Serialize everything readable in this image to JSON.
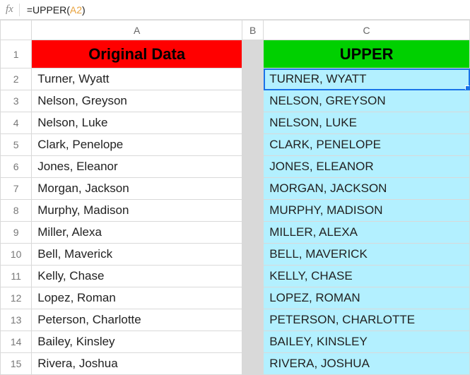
{
  "formula_bar": {
    "prefix": "=UPPER(",
    "ref": "A2",
    "suffix": ")"
  },
  "columns": {
    "a": "A",
    "b": "B",
    "c": "C"
  },
  "headers": {
    "original": "Original Data",
    "upper": "UPPER"
  },
  "rows": [
    {
      "num": "1"
    },
    {
      "num": "2",
      "a": "Turner, Wyatt",
      "c": "TURNER, WYATT"
    },
    {
      "num": "3",
      "a": "Nelson, Greyson",
      "c": "NELSON, GREYSON"
    },
    {
      "num": "4",
      "a": "Nelson, Luke",
      "c": "NELSON, LUKE"
    },
    {
      "num": "5",
      "a": "Clark, Penelope",
      "c": "CLARK, PENELOPE"
    },
    {
      "num": "6",
      "a": "Jones, Eleanor",
      "c": "JONES, ELEANOR"
    },
    {
      "num": "7",
      "a": "Morgan, Jackson",
      "c": "MORGAN, JACKSON"
    },
    {
      "num": "8",
      "a": "Murphy, Madison",
      "c": "MURPHY, MADISON"
    },
    {
      "num": "9",
      "a": "Miller, Alexa",
      "c": "MILLER, ALEXA"
    },
    {
      "num": "10",
      "a": "Bell, Maverick",
      "c": "BELL, MAVERICK"
    },
    {
      "num": "11",
      "a": "Kelly, Chase",
      "c": "KELLY, CHASE"
    },
    {
      "num": "12",
      "a": "Lopez, Roman",
      "c": "LOPEZ, ROMAN"
    },
    {
      "num": "13",
      "a": "Peterson, Charlotte",
      "c": "PETERSON, CHARLOTTE"
    },
    {
      "num": "14",
      "a": "Bailey, Kinsley",
      "c": "BAILEY, KINSLEY"
    },
    {
      "num": "15",
      "a": "Rivera, Joshua",
      "c": "RIVERA, JOSHUA"
    }
  ]
}
